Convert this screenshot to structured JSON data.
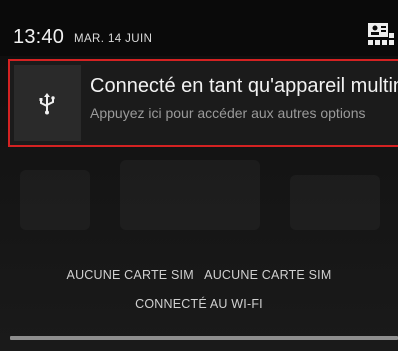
{
  "status_bar": {
    "time": "13:40",
    "date": "MAR. 14 JUIN"
  },
  "notification": {
    "icon": "usb-icon",
    "title": "Connecté en tant qu'appareil multin",
    "subtitle": "Appuyez ici pour accéder aux autres options",
    "highlight_color": "#d42222"
  },
  "carrier": {
    "line1": "AUCUNE CARTE SIM   AUCUNE CARTE SIM",
    "line2": "CONNECTÉ AU WI-FI"
  },
  "quick_settings_icon": "quick-settings-icon"
}
